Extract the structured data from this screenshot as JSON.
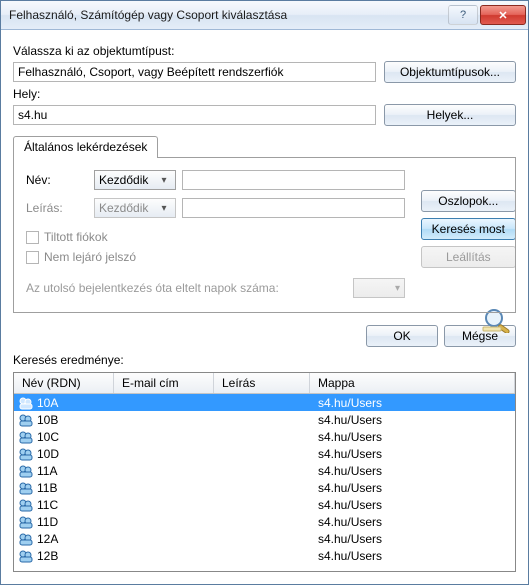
{
  "titlebar": {
    "title": "Felhasználó, Számítógép vagy Csoport kiválasztása"
  },
  "labels": {
    "select_object_type": "Válassza ki az objektumtípust:",
    "from_location": "Hely:",
    "search_results": "Keresés eredménye:"
  },
  "object_type": {
    "value": "Felhasználó, Csoport, vagy Beépített rendszerfiók"
  },
  "location": {
    "value": "s4.hu"
  },
  "buttons": {
    "object_types": "Objektumtípusok...",
    "locations": "Helyek...",
    "columns": "Oszlopok...",
    "find_now": "Keresés most",
    "stop": "Leállítás",
    "ok": "OK",
    "cancel": "Mégse"
  },
  "tab": {
    "label": "Általános lekérdezések"
  },
  "query": {
    "name_label": "Név:",
    "desc_label": "Leírás:",
    "name_mode": "Kezdődik",
    "desc_mode": "Kezdődik",
    "disabled_accounts_label": "Tiltott fiókok",
    "non_expiring_pw_label": "Nem lejáró jelszó",
    "days_since_login_label": "Az utolsó bejelentkezés óta eltelt napok száma:"
  },
  "columns": {
    "name": "Név (RDN)",
    "email": "E-mail cím",
    "desc": "Leírás",
    "folder": "Mappa"
  },
  "results": [
    {
      "name": "10A",
      "email": "",
      "desc": "",
      "folder": "s4.hu/Users"
    },
    {
      "name": "10B",
      "email": "",
      "desc": "",
      "folder": "s4.hu/Users"
    },
    {
      "name": "10C",
      "email": "",
      "desc": "",
      "folder": "s4.hu/Users"
    },
    {
      "name": "10D",
      "email": "",
      "desc": "",
      "folder": "s4.hu/Users"
    },
    {
      "name": "11A",
      "email": "",
      "desc": "",
      "folder": "s4.hu/Users"
    },
    {
      "name": "11B",
      "email": "",
      "desc": "",
      "folder": "s4.hu/Users"
    },
    {
      "name": "11C",
      "email": "",
      "desc": "",
      "folder": "s4.hu/Users"
    },
    {
      "name": "11D",
      "email": "",
      "desc": "",
      "folder": "s4.hu/Users"
    },
    {
      "name": "12A",
      "email": "",
      "desc": "",
      "folder": "s4.hu/Users"
    },
    {
      "name": "12B",
      "email": "",
      "desc": "",
      "folder": "s4.hu/Users"
    }
  ],
  "selected_index": 0
}
